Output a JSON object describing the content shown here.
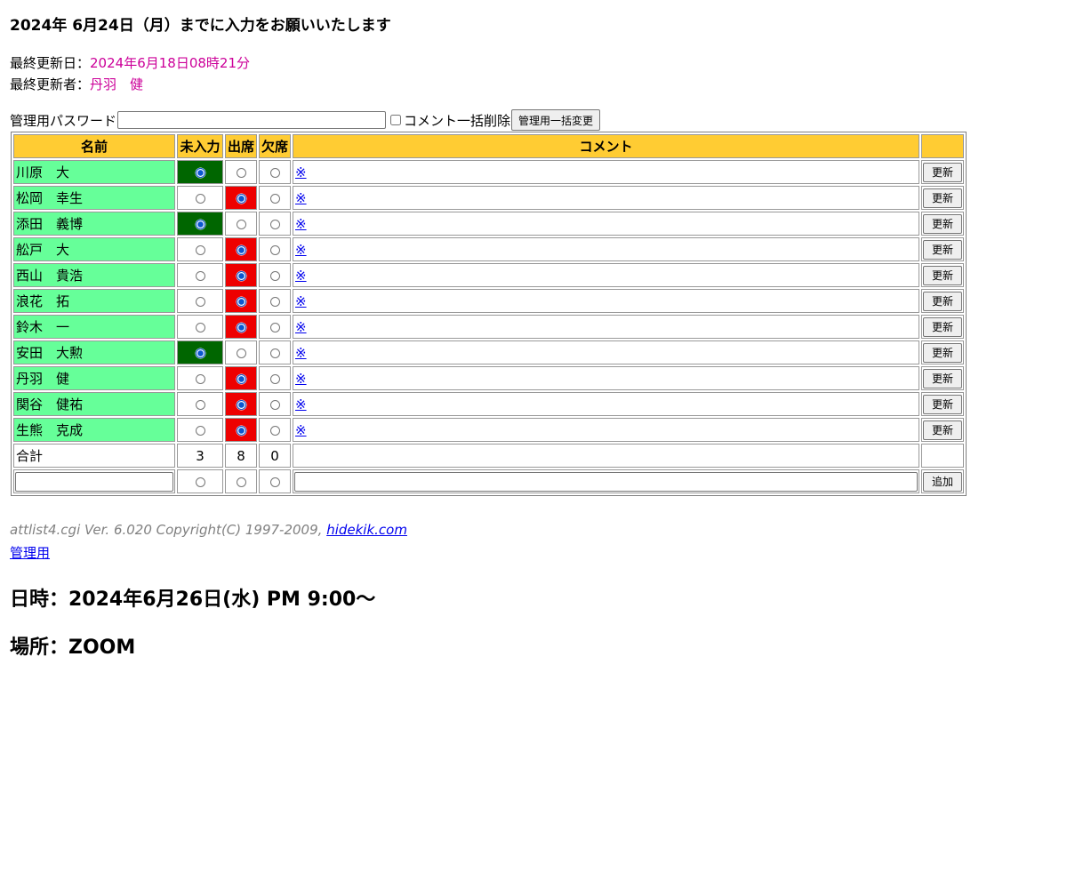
{
  "deadline": "2024年 6月24日（月）までに入力をお願いいたします",
  "last_updated_label": "最終更新日：",
  "last_updated_value": "2024年6月18日08時21分",
  "last_updater_label": "最終更新者：",
  "last_updater_value": "丹羽　健",
  "admin": {
    "password_label": "管理用パスワード",
    "password_value": "",
    "checkbox_label": "コメント一括削除",
    "checkbox_checked": false,
    "bulk_button": "管理用一括変更"
  },
  "table": {
    "headers": {
      "name": "名前",
      "mi": "未入力",
      "shusseki": "出席",
      "kesseki": "欠席",
      "comment": "コメント",
      "action": ""
    },
    "rows": [
      {
        "name": "川原　大",
        "status": "mi",
        "comment": "※",
        "button": "更新"
      },
      {
        "name": "松岡　幸生",
        "status": "shusseki",
        "comment": "※",
        "button": "更新"
      },
      {
        "name": "添田　義博",
        "status": "mi",
        "comment": "※",
        "button": "更新"
      },
      {
        "name": "舩戸　大",
        "status": "shusseki",
        "comment": "※",
        "button": "更新"
      },
      {
        "name": "西山　貴浩",
        "status": "shusseki",
        "comment": "※",
        "button": "更新"
      },
      {
        "name": "浪花　拓",
        "status": "shusseki",
        "comment": "※",
        "button": "更新"
      },
      {
        "name": "鈴木　一",
        "status": "shusseki",
        "comment": "※",
        "button": "更新"
      },
      {
        "name": "安田　大勲",
        "status": "mi",
        "comment": "※",
        "button": "更新"
      },
      {
        "name": "丹羽　健",
        "status": "shusseki",
        "comment": "※",
        "button": "更新"
      },
      {
        "name": "関谷　健祐",
        "status": "shusseki",
        "comment": "※",
        "button": "更新"
      },
      {
        "name": "生熊　克成",
        "status": "shusseki",
        "comment": "※",
        "button": "更新"
      }
    ],
    "total": {
      "label": "合計",
      "mi": "3",
      "shusseki": "8",
      "kesseki": "0"
    },
    "new_row": {
      "name_value": "",
      "comment_value": "",
      "button": "追加"
    }
  },
  "colors": {
    "mi_selected": "#006600",
    "shusseki_selected": "#ee0000",
    "name_bg": "#66ff99",
    "header_bg": "#ffcc33",
    "updated_text": "#cc0099"
  },
  "footer": {
    "copyright": "attlist4.cgi Ver. 6.020 Copyright(C) 1997-2009, ",
    "copyright_link": "hidekik.com",
    "admin_link": "管理用"
  },
  "event": {
    "when": "日時：2024年6月26日(水) PM 9:00～",
    "where": "場所：ZOOM"
  }
}
